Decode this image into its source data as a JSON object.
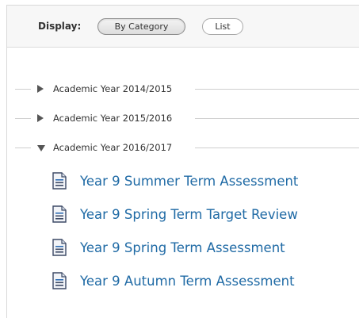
{
  "display": {
    "label": "Display:",
    "options": [
      {
        "label": "By Category",
        "selected": true
      },
      {
        "label": "List",
        "selected": false
      }
    ]
  },
  "years": [
    {
      "label": "Academic Year 2014/2015",
      "expanded": false
    },
    {
      "label": "Academic Year 2015/2016",
      "expanded": false
    },
    {
      "label": "Academic Year 2016/2017",
      "expanded": true
    }
  ],
  "assessments": [
    {
      "label": "Year 9 Summer Term Assessment",
      "icon": "document-icon"
    },
    {
      "label": "Year 9 Spring Term Target Review",
      "icon": "document-icon"
    },
    {
      "label": "Year 9 Spring Term Assessment",
      "icon": "document-icon"
    },
    {
      "label": "Year 9 Autumn Term Assessment",
      "icon": "document-icon"
    }
  ],
  "colors": {
    "link": "#1f6aa5",
    "icon_dark": "#3d4a66",
    "icon_accent": "#2e6db4"
  }
}
